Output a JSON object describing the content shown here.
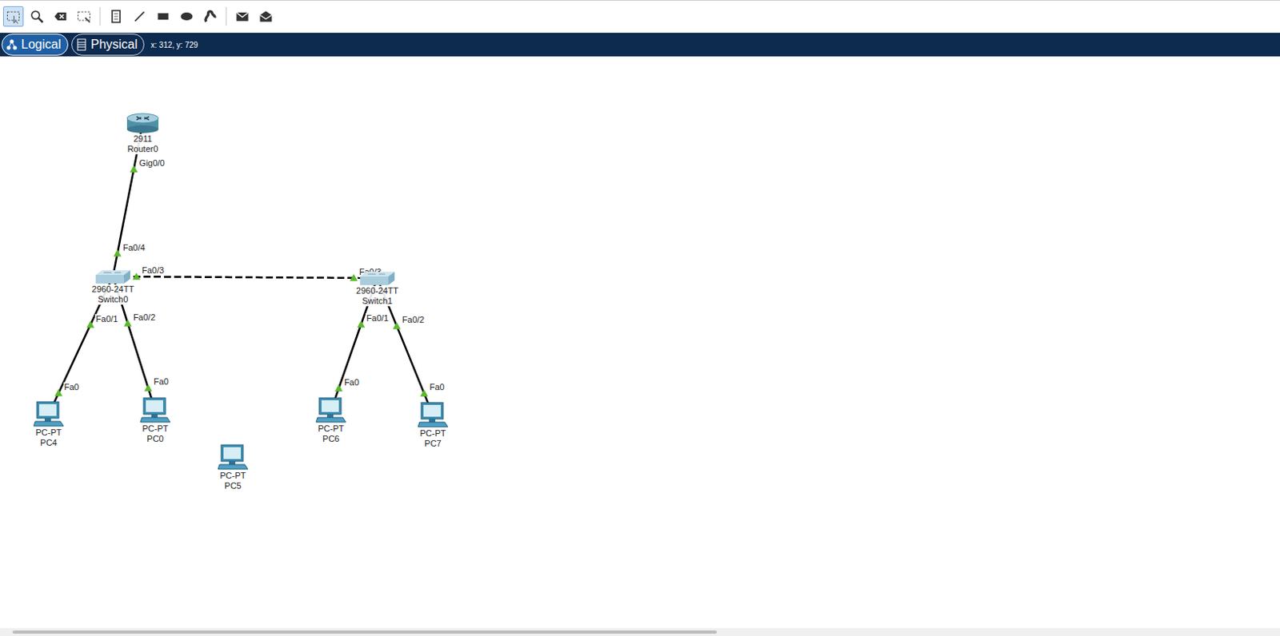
{
  "toolbar": {
    "tools": [
      {
        "kind": "select",
        "selected": true
      },
      {
        "kind": "inspect",
        "selected": false
      },
      {
        "kind": "delete",
        "selected": false
      },
      {
        "kind": "resize",
        "selected": false
      },
      {
        "kind": "note",
        "selected": false
      },
      {
        "kind": "line",
        "selected": false
      },
      {
        "kind": "rectangle",
        "selected": false
      },
      {
        "kind": "ellipse",
        "selected": false
      },
      {
        "kind": "freehand",
        "selected": false
      },
      {
        "kind": "simple-pdu",
        "selected": false
      },
      {
        "kind": "complex-pdu",
        "selected": false
      }
    ]
  },
  "view_tabs": [
    {
      "label": "Logical",
      "selected": true
    },
    {
      "label": "Physical",
      "selected": false
    }
  ],
  "cursor_position": "x: 312, y: 729",
  "nodes": [
    {
      "model": "2911",
      "name": "Router0",
      "kind": "router"
    },
    {
      "model": "2960-24TT",
      "name": "Switch0",
      "kind": "switch"
    },
    {
      "model": "2960-24TT",
      "name": "Switch1",
      "kind": "switch"
    },
    {
      "model": "PC-PT",
      "name": "PC4",
      "kind": "pc"
    },
    {
      "model": "PC-PT",
      "name": "PC0",
      "kind": "pc"
    },
    {
      "model": "PC-PT",
      "name": "PC5",
      "kind": "pc"
    },
    {
      "model": "PC-PT",
      "name": "PC6",
      "kind": "pc"
    },
    {
      "model": "PC-PT",
      "name": "PC7",
      "kind": "pc"
    }
  ],
  "links": [
    {
      "from": 0,
      "from_port": "Gig0/0",
      "to": 1,
      "to_port": "Fa0/4",
      "kind": "straight",
      "up": true
    },
    {
      "from": 1,
      "from_port": "Fa0/3",
      "to": 2,
      "to_port": "Fa0/3",
      "kind": "crossover",
      "up": true
    },
    {
      "from": 1,
      "from_port": "Fa0/1",
      "to": 3,
      "to_port": "Fa0",
      "kind": "straight",
      "up": true
    },
    {
      "from": 1,
      "from_port": "Fa0/2",
      "to": 4,
      "to_port": "Fa0",
      "kind": "straight",
      "up": true
    },
    {
      "from": 2,
      "from_port": "Fa0/1",
      "to": 6,
      "to_port": "Fa0",
      "kind": "straight",
      "up": true
    },
    {
      "from": 2,
      "from_port": "Fa0/2",
      "to": 7,
      "to_port": "Fa0",
      "kind": "straight",
      "up": true
    }
  ],
  "scrollbar": {
    "level": 0.55
  }
}
